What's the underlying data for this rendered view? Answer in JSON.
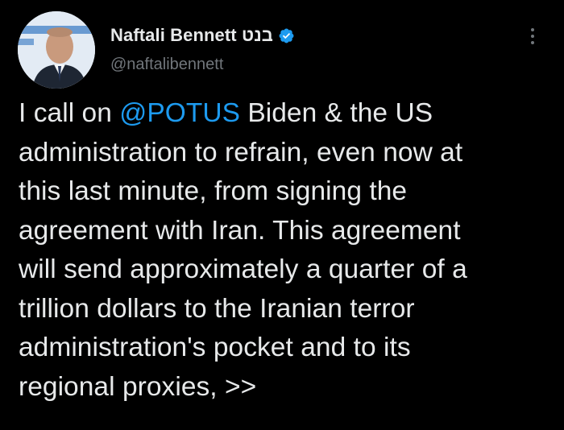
{
  "author": {
    "display_name": "Naftali Bennett בנט",
    "handle": "@naftalibennett",
    "avatar_icon": "profile-photo",
    "verified_icon": "verified-badge-icon",
    "verified_color": "#1d9bf0"
  },
  "menu": {
    "more_icon": "more-options-icon"
  },
  "tweet": {
    "lines": [
      {
        "before": "I call on ",
        "mention": "@POTUS",
        "after": " Biden & the US"
      },
      {
        "text": "administration to refrain, even now at"
      },
      {
        "text": "this last minute, from signing the"
      },
      {
        "text": "agreement with Iran. This agreement"
      },
      {
        "text": "will send approximately a quarter of a"
      },
      {
        "text": "trillion dollars to the Iranian terror"
      },
      {
        "text": "administration's pocket and to its"
      },
      {
        "text": "regional proxies, >>"
      }
    ]
  },
  "colors": {
    "background": "#000000",
    "text": "#e7e9ea",
    "secondary_text": "#71767b",
    "link": "#1d9bf0"
  }
}
